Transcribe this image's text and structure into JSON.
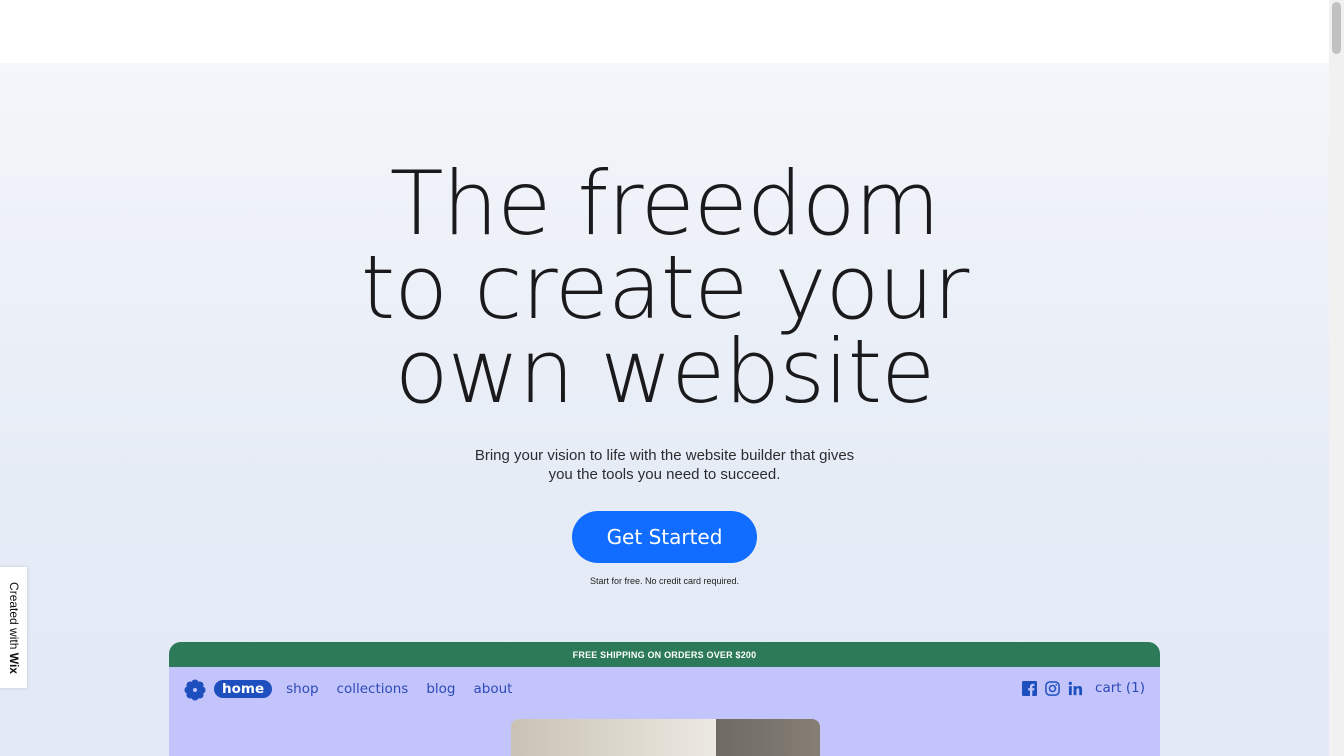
{
  "hero": {
    "headline_lines": [
      "The freedom",
      "to create your",
      "own website"
    ],
    "subtitle_lines": [
      "Bring your vision to life with the website builder that gives",
      "you the tools you need to succeed."
    ],
    "cta_label": "Get Started",
    "cta_note": "Start for free. No credit card required."
  },
  "badge": {
    "prefix": "Created with ",
    "brand": "Wix"
  },
  "preview": {
    "announcement": "FREE SHIPPING ON ORDERS OVER $200",
    "logo_icon": "flower-icon",
    "nav": [
      "home",
      "shop",
      "collections",
      "blog",
      "about"
    ],
    "active_nav": "home",
    "social_icons": [
      "facebook-icon",
      "instagram-icon",
      "linkedin-icon"
    ],
    "cart_label": "cart (1)"
  },
  "colors": {
    "cta": "#116dff",
    "announcement_bg": "#2c7a57",
    "preview_bg": "#c2c4fb",
    "nav_text": "#2e4ab8",
    "nav_active_bg": "#1e4fbf"
  }
}
